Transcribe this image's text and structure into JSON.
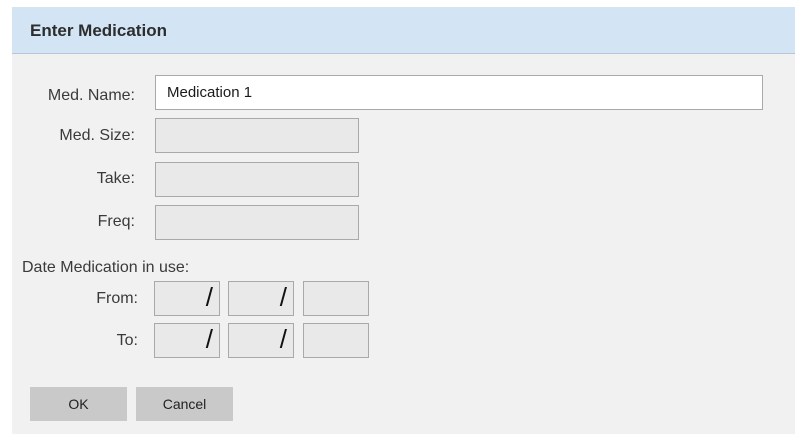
{
  "dialog": {
    "title": "Enter Medication"
  },
  "form": {
    "med_name_label": "Med. Name:",
    "med_name_value": "Medication 1",
    "med_size_label": "Med. Size:",
    "med_size_value": "",
    "take_label": "Take:",
    "take_value": "",
    "freq_label": "Freq:",
    "freq_value": "",
    "date_section_label": "Date Medication in use:",
    "from_label": "From:",
    "to_label": "To:",
    "date_separator": "/",
    "from_month": "",
    "from_day": "",
    "from_year": "",
    "to_month": "",
    "to_day": "",
    "to_year": ""
  },
  "buttons": {
    "ok_label": "OK",
    "cancel_label": "Cancel"
  },
  "colors": {
    "title_bar": "#d3e5f5",
    "dialog_background": "#f1f1f2",
    "field_background": "#e9e9e9",
    "active_field_background": "#ffffff",
    "button_background": "#c9c9c9"
  }
}
